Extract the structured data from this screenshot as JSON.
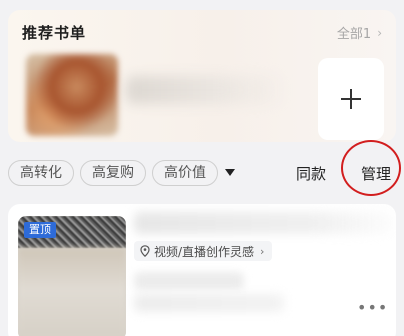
{
  "book_list": {
    "title": "推荐书单",
    "all_label": "全部1",
    "chevron": "›",
    "add_icon": "plus-icon"
  },
  "filters": {
    "chips": [
      "高转化",
      "高复购",
      "高价值"
    ],
    "dropdown_icon": "caret-down-icon",
    "same_label": "同款",
    "manage_label": "管理",
    "highlight_color": "#d21e1e"
  },
  "product": {
    "pin_label": "置顶",
    "tag_label": "视频/直播创作灵感",
    "tag_chevron": "›",
    "more_label": "•••",
    "accent": "#2e6bd8"
  }
}
